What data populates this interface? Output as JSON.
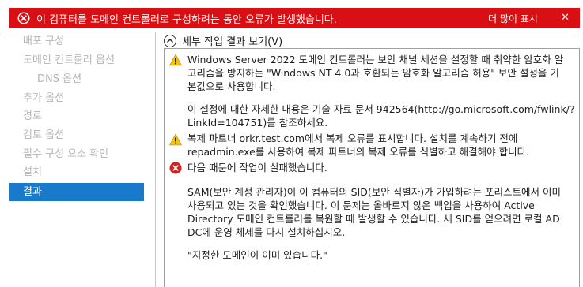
{
  "banner": {
    "message": "이 컴퓨터를 도메인 컨트롤러로 구성하려는 동안 오류가 발생했습니다.",
    "more_label": "더 많이 표시",
    "close_label": "✕",
    "color": "#d90f14"
  },
  "sidebar": {
    "items": [
      {
        "label": "배포 구성",
        "state": "disabled"
      },
      {
        "label": "도메인 컨트롤러 옵션",
        "state": "disabled"
      },
      {
        "label": "DNS 옵션",
        "state": "disabled",
        "sub": true
      },
      {
        "label": "추가 옵션",
        "state": "disabled"
      },
      {
        "label": "경로",
        "state": "disabled"
      },
      {
        "label": "검토 옵션",
        "state": "disabled"
      },
      {
        "label": "필수 구성 요소 확인",
        "state": "disabled"
      },
      {
        "label": "설치",
        "state": "disabled"
      },
      {
        "label": "결과",
        "state": "active"
      }
    ],
    "active_color": "#1979ca"
  },
  "details": {
    "toggle_label": "세부 작업 결과 보기(V)"
  },
  "messages": {
    "warning1": {
      "icon": "warning-icon",
      "lines": [
        "Windows Server 2022 도메인 컨트롤러는 보안 채널 세션을 설정할 때 취약한 암호화 알",
        "고리즘을 방지하는 \"Windows NT 4.0과 호환되는 암호화 알고리즘 허용\" 보안 설정을 기",
        "본값으로 사용합니다."
      ],
      "extra_lines": [
        "이 설정에 대한 자세한 내용은 기술 자료 문서 942564(http://go.microsoft.com/fwlink/?",
        "LinkId=104751)를 참조하세요."
      ]
    },
    "warning2": {
      "icon": "warning-icon",
      "lines": [
        "복제 파트너 orkr.test.com에서 복제 오류를 표시합니다. 설치를 계속하기 전에",
        "repadmin.exe를 사용하여 복제 파트너의 복제 오류를 식별하고 해결해야 합니다."
      ]
    },
    "error1": {
      "icon": "error-icon",
      "lines": [
        "다음 때문에 작업이 실패했습니다."
      ],
      "extra_lines": [
        "SAM(보안 계정 관리자)이 이 컴퓨터의 SID(보안 식별자)가 가입하려는 포리스트에서 이미",
        "사용되고 있는 것을 확인했습니다. 이 문제는 올바르지 않은 백업을 사용하여 Active",
        "Directory 도메인 컨트롤러를 복원할 때 발생할 수 있습니다. 새 SID를 얻으려면 로컬 AD",
        "DC에 운영 체제를 다시 설치하십시오."
      ],
      "quote": "\"지정한 도메인이 이미 있습니다.\""
    }
  }
}
